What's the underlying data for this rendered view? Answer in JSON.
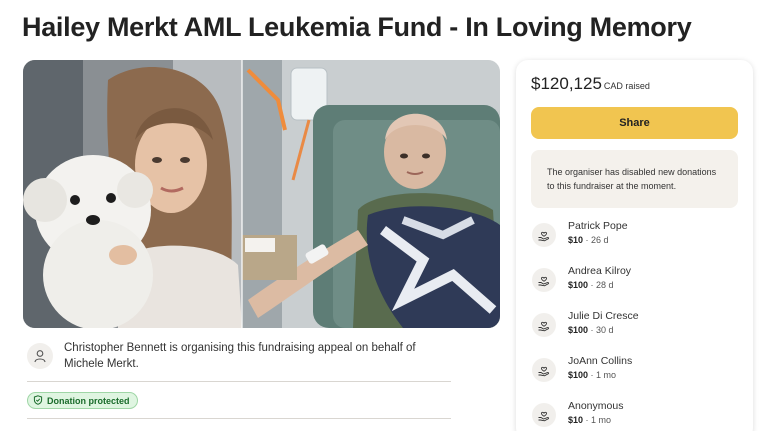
{
  "page": {
    "title": "Hailey Merkt AML Leukemia Fund - In Loving Memory"
  },
  "organiser": {
    "text": "Christopher Bennett is organising this fundraising appeal on behalf of Michele Merkt.",
    "icon": "person-icon"
  },
  "badge": {
    "label": "Donation protected",
    "icon": "shield-check-icon"
  },
  "sidebar": {
    "amount": "$120,125",
    "currency": "CAD raised",
    "share_label": "Share",
    "notice": "The organiser has disabled new donations to this fundraiser at the moment.",
    "donations": [
      {
        "name": "Patrick Pope",
        "amount": "$10",
        "time": " · 26 d",
        "icon": "donation-hand-heart-icon"
      },
      {
        "name": "Andrea Kilroy",
        "amount": "$100",
        "time": " · 28 d",
        "icon": "donation-hand-heart-icon"
      },
      {
        "name": "Julie Di Cresce",
        "amount": "$100",
        "time": " · 30 d",
        "icon": "donation-hand-heart-icon"
      },
      {
        "name": "JoAnn Collins",
        "amount": "$100",
        "time": " · 1 mo",
        "icon": "donation-hand-heart-icon"
      },
      {
        "name": "Anonymous",
        "amount": "$10",
        "time": " · 1 mo",
        "icon": "donation-hand-heart-icon"
      }
    ]
  },
  "colors": {
    "share_button": "#f1c550",
    "notice_bg": "#f4f1ec",
    "badge_bg": "#dff5e1",
    "badge_text": "#1a6b2b"
  }
}
